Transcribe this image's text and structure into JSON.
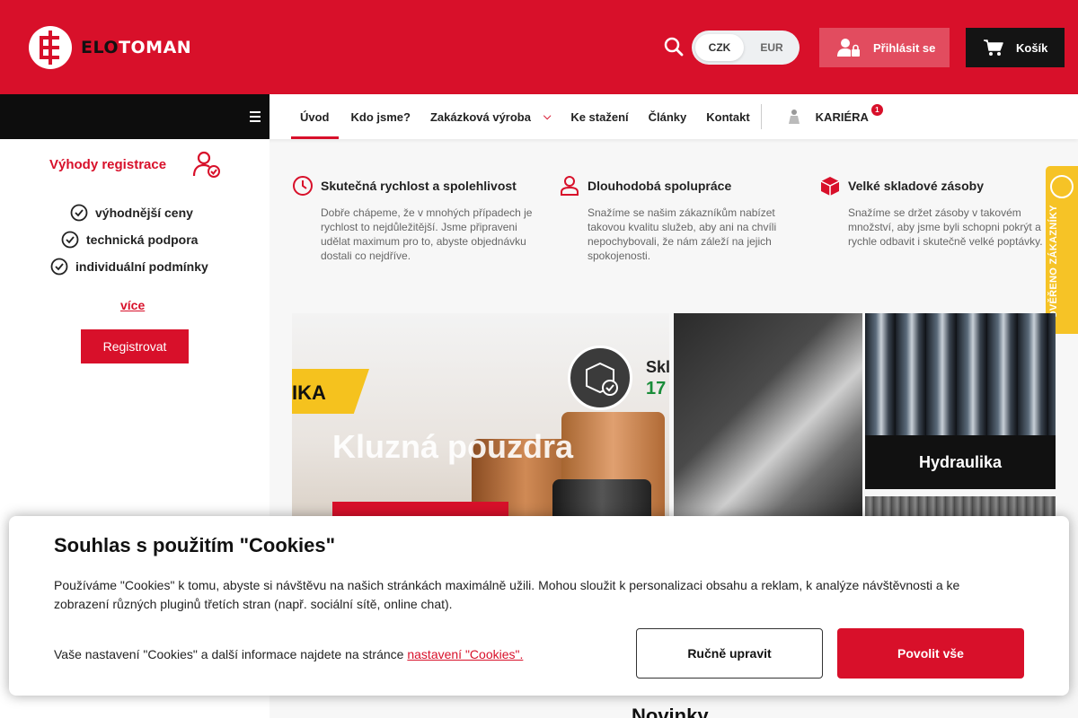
{
  "brand": {
    "part1": "ELO",
    "part2": "TOMAN"
  },
  "header": {
    "currencies": [
      "CZK",
      "EUR"
    ],
    "login_label": "Přihlásit se",
    "cart_label": "Košík"
  },
  "nav": {
    "items": [
      "Úvod",
      "Kdo jsme?",
      "Zakázková výroba",
      "Ke stažení",
      "Články",
      "Kontakt"
    ],
    "career_label": "KARIÉRA",
    "career_badge": "1"
  },
  "sidebar": {
    "title": "Výhody registrace",
    "benefits": [
      "výhodnější ceny",
      "technická podpora",
      "individuální podmínky"
    ],
    "more_label": "více",
    "register_label": "Registrovat"
  },
  "features": [
    {
      "title": "Skutečná rychlost a spolehlivost",
      "text": "Dobře chápeme, že v mnohých případech je rychlost to nejdůležitější. Jsme připraveni udělat maximum pro to, abyste objednávku dostali co nejdříve.",
      "icon": "clock-icon"
    },
    {
      "title": "Dlouhodobá spolupráce",
      "text": "Snažíme se našim zákazníkům nabízet takovou kvalitu služeb, aby ani na chvíli nepochybovali, že nám záleží na jejich spokojenosti.",
      "icon": "person-icon"
    },
    {
      "title": "Velké skladové zásoby",
      "text": "Snažíme se držet zásoby v takovém množství, aby jsme byli schopni pokrýt a rychle odbavit i skutečně velké poptávky.",
      "icon": "box-icon"
    }
  ],
  "verified_label": "OVĚŘENO ZÁKAZNÍKY",
  "banner": {
    "title": "Kluzná pouzdra",
    "badge_text": "IKA",
    "stock_text": "Skl",
    "stock_number": "17"
  },
  "tiles": {
    "hydraulics": "Hydraulika"
  },
  "news_heading": "Novinky",
  "cookie": {
    "title": "Souhlas s použitím \"Cookies\"",
    "text": "Používáme \"Cookies\" k tomu, abyste si návštěvu na našich stránkách maximálně užili. Mohou sloužit k personalizaci obsahu a reklam, k analýze návštěvnosti a ke zobrazení různých pluginů třetích stran (např. sociální sítě, online chat).",
    "settings_prefix": "Vaše nastavení \"Cookies\" a další informace najdete na stránce ",
    "settings_link": "nastavení \"Cookies\".",
    "manual_label": "Ručně upravit",
    "allow_label": "Povolit vše"
  },
  "colors": {
    "brand_red": "#d8102a",
    "dark": "#141414",
    "verified_yellow": "#f6c326"
  }
}
